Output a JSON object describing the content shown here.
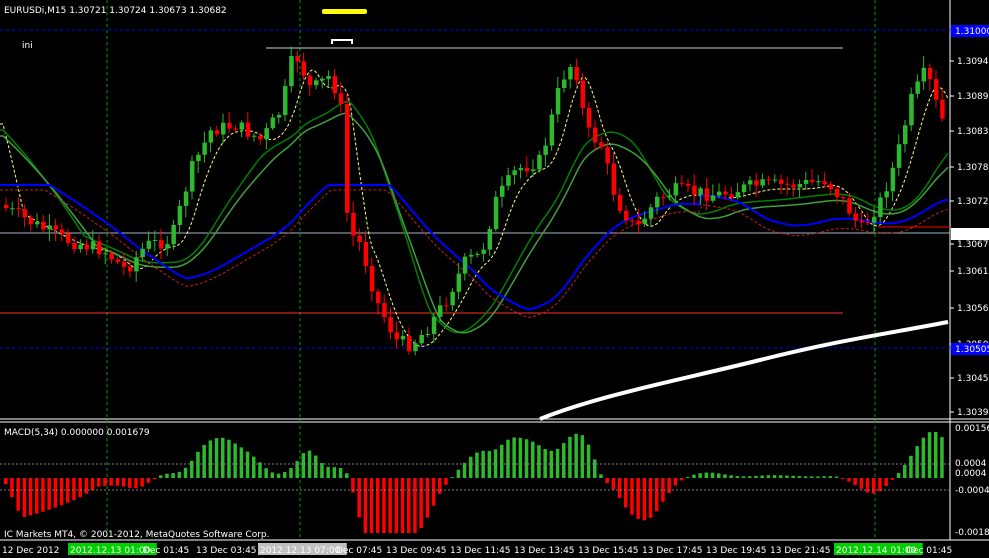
{
  "header": {
    "title": "EURUSDi,M15  1.30721 1.30724 1.30673 1.30682",
    "mini_label": "ini"
  },
  "indicator": {
    "title": "MACD(5,34) 0.000000 0.001679"
  },
  "copyright": "IC Markets MT4, © 2001-2012, MetaQuotes Software Corp.",
  "price_axis": {
    "labels": [
      "1.30945",
      "1.30890",
      "1.30835",
      "1.30780",
      "1.30725",
      "1.30670",
      "1.30615",
      "1.30560",
      "1.30505",
      "1.30450",
      "1.30395"
    ],
    "markers": [
      {
        "text": "1.31000",
        "bg": "#0000ff",
        "color": "#000000"
      },
      {
        "text": "1.30682",
        "bg": "#ffffff",
        "color": "#000000"
      },
      {
        "text": "1.30505",
        "bg": "#0000ff",
        "color": "#000000"
      }
    ]
  },
  "macd_axis": {
    "labels": [
      "0.001564",
      "0.0004",
      "0.0004",
      "-0.0004",
      "-0.001891"
    ]
  },
  "time_axis": {
    "labels": [
      "12 Dec 2012",
      "2012.12.13 01:00",
      "Dec 01:45",
      "13 Dec 03:45",
      "2012.12.13 07:00",
      "Dec 07:45",
      "13 Dec 09:45",
      "13 Dec 11:45",
      "13 Dec 13:45",
      "13 Dec 15:45",
      "13 Dec 17:45",
      "13 Dec 19:45",
      "13 Dec 21:45",
      "2012.12.14 01:00",
      "Dec 01:45"
    ],
    "highlight_green": "#00d000",
    "highlight_grey": "#c0c0c0"
  },
  "colors": {
    "bull": "#2db82d",
    "bear": "#ff0000",
    "grid": "#004000",
    "hline_blue": "#0000ff",
    "ma_white": "#ffffff",
    "ma_blue": "#0000ff",
    "ma_green": "#008000"
  }
}
